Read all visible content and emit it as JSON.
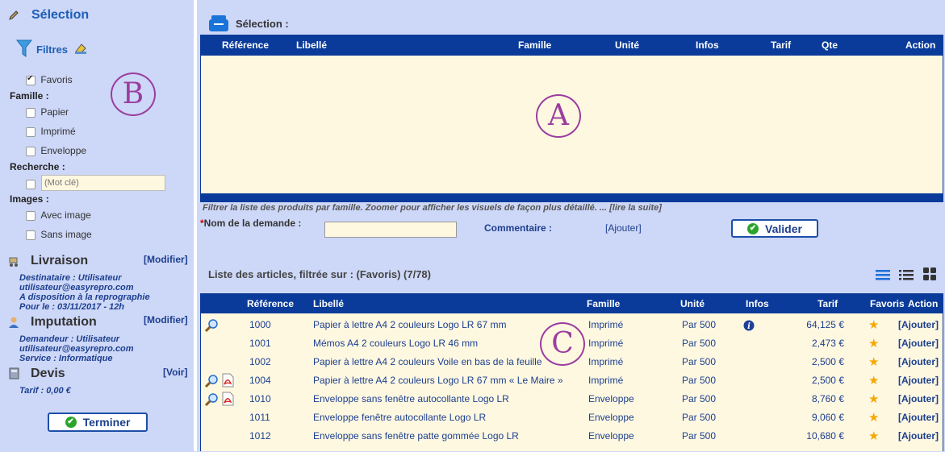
{
  "sidebar": {
    "title": "Sélection",
    "filters_label": "Filtres",
    "favoris_label": "Favoris",
    "famille_label": "Famille :",
    "famille_items": [
      "Papier",
      "Imprimé",
      "Enveloppe"
    ],
    "recherche_label": "Recherche :",
    "search_placeholder": "(Mot clé)",
    "images_label": "Images :",
    "images_items": [
      "Avec image",
      "Sans image"
    ],
    "marker": "B",
    "livraison": {
      "title": "Livraison",
      "action": "[Modifier]",
      "lines": [
        "Destinataire : Utilisateur",
        "utilisateur@easyrepro.com",
        "A disposition à la reprographie",
        "Pour le : 03/11/2017 - 12h"
      ]
    },
    "imputation": {
      "title": "Imputation",
      "action": "[Modifier]",
      "lines": [
        "Demandeur : Utilisateur",
        "utilisateur@easyrepro.com",
        "Service : Informatique"
      ]
    },
    "devis": {
      "title": "Devis",
      "action": "[Voir]",
      "tarif": "Tarif : 0,00 €"
    },
    "terminer_label": "Terminer"
  },
  "selection": {
    "title": "Sélection :",
    "headers": [
      "Référence",
      "Libellé",
      "Famille",
      "Unité",
      "Infos",
      "Tarif",
      "Qte",
      "Action"
    ],
    "marker": "A",
    "hint": "Filtrer la liste des produits par famille. Zoomer pour afficher les visuels de façon plus détaillé. ... [lire la suite]",
    "nom_label": "Nom de la demande :",
    "required_mark": "*",
    "commentaire_label": "Commentaire :",
    "ajouter_label": "[Ajouter]",
    "valider_label": "Valider"
  },
  "liste": {
    "title": "Liste des articles, filtrée sur : (Favoris) (7/78)",
    "headers": [
      "Référence",
      "Libellé",
      "Famille",
      "Unité",
      "Infos",
      "Tarif",
      "Favoris",
      "Action"
    ],
    "marker": "C",
    "rows": [
      {
        "zoom": true,
        "pdf": false,
        "ref": "1000",
        "libelle": "Papier à lettre A4 2 couleurs Logo LR 67 mm",
        "famille": "Imprimé",
        "unite": "Par 500",
        "info": true,
        "tarif": "64,125 €",
        "action": "[Ajouter]"
      },
      {
        "zoom": false,
        "pdf": false,
        "ref": "1001",
        "libelle": "Mémos A4 2 couleurs Logo LR 46 mm",
        "famille": "Imprimé",
        "unite": "Par 500",
        "info": false,
        "tarif": "2,473 €",
        "action": "[Ajouter]"
      },
      {
        "zoom": false,
        "pdf": false,
        "ref": "1002",
        "libelle": "Papier à lettre A4 2 couleurs Voile en bas de la feuille",
        "famille": "Imprimé",
        "unite": "Par 500",
        "info": false,
        "tarif": "2,500 €",
        "action": "[Ajouter]"
      },
      {
        "zoom": true,
        "pdf": true,
        "ref": "1004",
        "libelle": "Papier à lettre A4 2 couleurs Logo LR 67 mm « Le Maire »",
        "famille": "Imprimé",
        "unite": "Par 500",
        "info": false,
        "tarif": "2,500 €",
        "action": "[Ajouter]"
      },
      {
        "zoom": true,
        "pdf": true,
        "ref": "1010",
        "libelle": "Enveloppe sans fenêtre autocollante Logo LR",
        "famille": "Enveloppe",
        "unite": "Par 500",
        "info": false,
        "tarif": "8,760 €",
        "action": "[Ajouter]"
      },
      {
        "zoom": false,
        "pdf": false,
        "ref": "1011",
        "libelle": "Enveloppe fenêtre autocollante Logo LR",
        "famille": "Enveloppe",
        "unite": "Par 500",
        "info": false,
        "tarif": "9,060 €",
        "action": "[Ajouter]"
      },
      {
        "zoom": false,
        "pdf": false,
        "ref": "1012",
        "libelle": "Enveloppe sans fenêtre patte gommée Logo LR",
        "famille": "Enveloppe",
        "unite": "Par 500",
        "info": false,
        "tarif": "10,680 €",
        "action": "[Ajouter]"
      }
    ]
  },
  "colors": {
    "header_blue": "#0b3b9a",
    "cream": "#fff8e1",
    "page_bg": "#cdd7f7",
    "accent_purple": "#9b3da0"
  }
}
